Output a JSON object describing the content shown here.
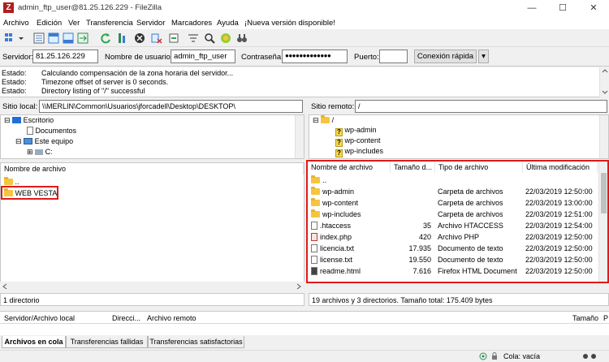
{
  "window": {
    "title": "admin_ftp_user@81.25.126.229 - FileZilla",
    "app_icon": "Z",
    "controls": [
      "—",
      "☐",
      "✕"
    ]
  },
  "menu": [
    "Archivo",
    "Edición",
    "Ver",
    "Transferencia",
    "Servidor",
    "Marcadores",
    "Ayuda",
    "¡Nueva versión disponible!"
  ],
  "quickconnect": {
    "host_label": "Servidor:",
    "host_value": "81.25.126.229",
    "user_label": "Nombre de usuario:",
    "user_value": "admin_ftp_user",
    "pass_label": "Contraseña:",
    "pass_value": "●●●●●●●●●●●●●",
    "port_label": "Puerto:",
    "port_value": "",
    "connect_label": "Conexión rápida",
    "dropdown": "▾"
  },
  "log": [
    {
      "key": "Estado:",
      "msg": "Calculando compensación de la zona horaria del servidor..."
    },
    {
      "key": "Estado:",
      "msg": "Timezone offset of server is 0 seconds."
    },
    {
      "key": "Estado:",
      "msg": "Directory listing of \"/\" successful"
    }
  ],
  "local": {
    "site_label": "Sitio local:",
    "path": "\\\\MERLIN\\Common\\Usuarios\\jforcadell\\Desktop\\DESKTOP\\",
    "tree": [
      {
        "label": "Escritorio",
        "toggle": "⊟"
      },
      {
        "label": "Documentos",
        "toggle": ""
      },
      {
        "label": "Este equipo",
        "toggle": "⊟"
      },
      {
        "label": "C:",
        "toggle": "⊞"
      }
    ],
    "header": "Nombre de archivo",
    "files": [
      {
        "name": ".."
      },
      {
        "name": "WEB VESTA"
      }
    ],
    "status": "1 directorio"
  },
  "remote": {
    "site_label": "Sitio remoto:",
    "path": "/",
    "tree": [
      {
        "label": "/",
        "toggle": "⊟"
      },
      {
        "label": "wp-admin"
      },
      {
        "label": "wp-content"
      },
      {
        "label": "wp-includes"
      }
    ],
    "headers": [
      "Nombre de archivo",
      "Tamaño d...",
      "Tipo de archivo",
      "Última modificación"
    ],
    "files": [
      {
        "name": "..",
        "size": "",
        "type": "",
        "date": "",
        "icon": "folder"
      },
      {
        "name": "wp-admin",
        "size": "",
        "type": "Carpeta de archivos",
        "date": "22/03/2019 12:50:00",
        "icon": "folder"
      },
      {
        "name": "wp-content",
        "size": "",
        "type": "Carpeta de archivos",
        "date": "22/03/2019 13:00:00",
        "icon": "folder"
      },
      {
        "name": "wp-includes",
        "size": "",
        "type": "Carpeta de archivos",
        "date": "22/03/2019 12:51:00",
        "icon": "folder"
      },
      {
        "name": ".htaccess",
        "size": "35",
        "type": "Archivo HTACCESS",
        "date": "22/03/2019 12:54:00",
        "icon": "file"
      },
      {
        "name": "index.php",
        "size": "420",
        "type": "Archivo PHP",
        "date": "22/03/2019 12:50:00",
        "icon": "php"
      },
      {
        "name": "licencia.txt",
        "size": "17.935",
        "type": "Documento de texto",
        "date": "22/03/2019 12:50:00",
        "icon": "file"
      },
      {
        "name": "license.txt",
        "size": "19.550",
        "type": "Documento de texto",
        "date": "22/03/2019 12:50:00",
        "icon": "file"
      },
      {
        "name": "readme.html",
        "size": "7.616",
        "type": "Firefox HTML Document",
        "date": "22/03/2019 12:50:00",
        "icon": "html"
      }
    ],
    "status": "19 archivos y 3 directorios. Tamaño total: 175.409 bytes"
  },
  "queue": {
    "headers": [
      "Servidor/Archivo local",
      "Direcci...",
      "Archivo remoto",
      "Tamaño",
      "P"
    ],
    "tabs": [
      "Archivos en cola",
      "Transferencias fallidas",
      "Transferencias satisfactorias"
    ]
  },
  "statusbar": {
    "queue": "Cola: vacía"
  },
  "colors": {
    "highlight": "#e01a1a",
    "folder": "#f5c542",
    "accent_blue": "#1e6fd9"
  }
}
